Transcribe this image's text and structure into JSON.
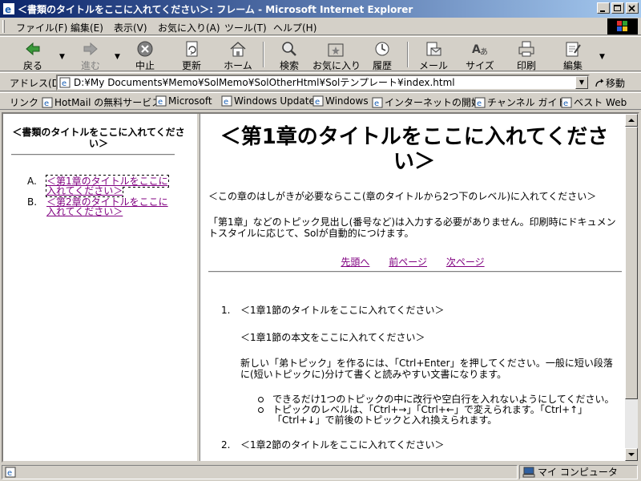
{
  "window": {
    "title": "＜書類のタイトルをここに入れてください＞: フレーム - Microsoft Internet Explorer"
  },
  "menu": {
    "items": [
      "ファイル(F)",
      "編集(E)",
      "表示(V)",
      "お気に入り(A)",
      "ツール(T)",
      "ヘルプ(H)"
    ]
  },
  "toolbar": {
    "back": "戻る",
    "forward": "進む",
    "stop": "中止",
    "refresh": "更新",
    "home": "ホーム",
    "search": "検索",
    "favorites": "お気に入り",
    "history": "履歴",
    "mail": "メール",
    "size": "サイズ",
    "print": "印刷",
    "edit": "編集"
  },
  "address": {
    "label": "アドレス(D)",
    "value": "D:¥My Documents¥Memo¥SolMemo¥SolOtherHtml¥Solテンプレート¥index.html",
    "go": "移動"
  },
  "links": {
    "label": "リンク",
    "items": [
      "HotMail の無料サービス",
      "Microsoft",
      "Windows Update",
      "Windows",
      "インターネットの開始",
      "チャンネル ガイド",
      "ベスト Web"
    ]
  },
  "toc": {
    "title": "＜書類のタイトルをここに入れてください＞",
    "items": [
      {
        "num": "A.",
        "text": "＜第1章のタイトルをここに入れてください＞"
      },
      {
        "num": "B.",
        "text": "＜第2章のタイトルをここに入れてください＞"
      }
    ]
  },
  "main": {
    "chapter_title": "＜第1章のタイトルをここに入れてください＞",
    "intro": "＜この章のはしがきが必要ならここ(章のタイトルから2つ下のレベル)に入れてください＞",
    "note": "「第1章」などのトピック見出し(番号など)は入力する必要がありません。印刷時にドキュメントスタイルに応じて、Solが自動的につけます。",
    "nav": {
      "top": "先頭へ",
      "prev": "前ページ",
      "next": "次ページ"
    },
    "sections": [
      {
        "num": "1.",
        "title": "＜1章1節のタイトルをここに入れてください＞"
      },
      {
        "num": "2.",
        "title": "＜1章2節のタイトルをここに入れてください＞"
      }
    ],
    "sec1_body": "＜1章1節の本文をここに入れてください＞",
    "sec1_para": "新しい「弟トピック」を作るには、「Ctrl+Enter」を押してください。一般に短い段落に(短いトピックに)分けて書くと読みやすい文書になります。",
    "bullets": [
      "できるだけ1つのトピックの中に改行や空白行を入れないようにしてください。",
      "トピックのレベルは、「Ctrl+→」「Ctrl+←」で変えられます。「Ctrl+↑」「Ctrl+↓」で前後のトピックと入れ換えられます。"
    ]
  },
  "status": {
    "zone": "マイ コンピュータ"
  }
}
